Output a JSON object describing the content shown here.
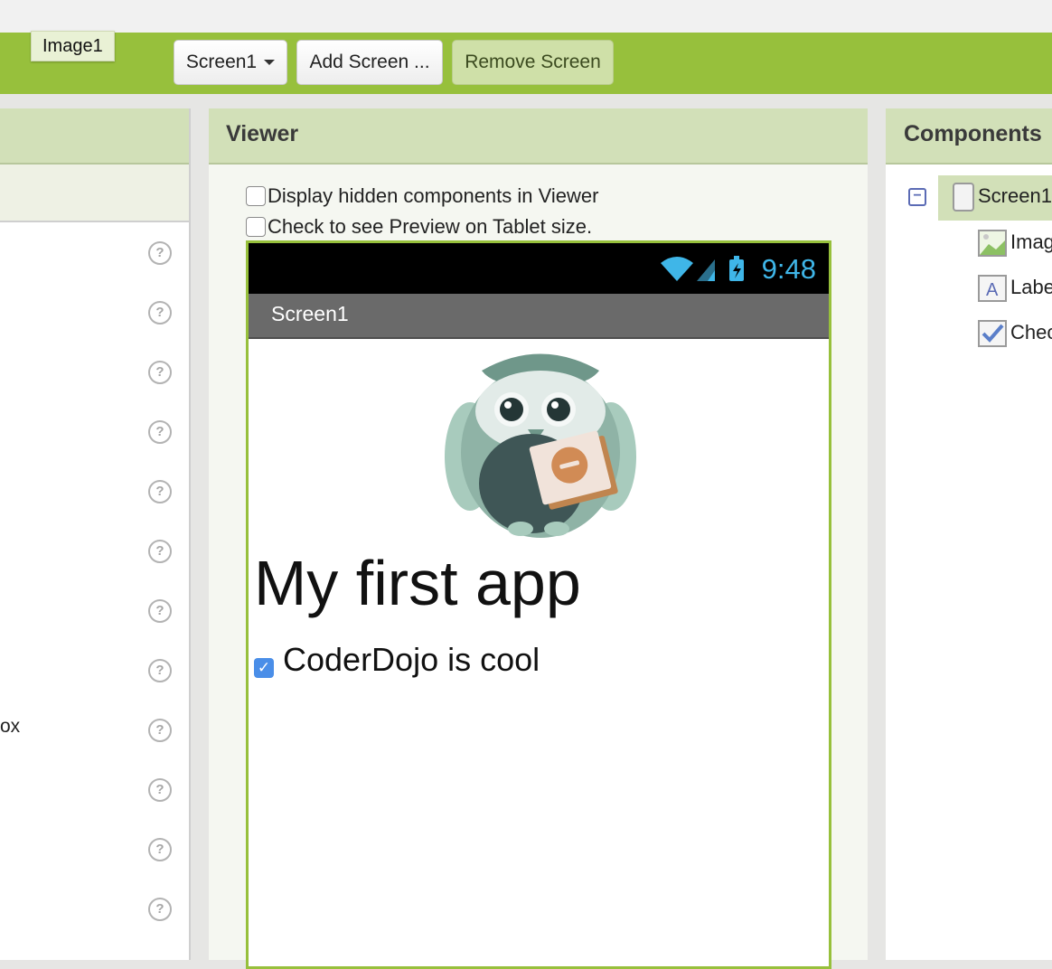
{
  "tooltip": "Image1",
  "toolbar": {
    "screen_dropdown": "Screen1",
    "add_screen": "Add Screen ...",
    "remove_screen": "Remove Screen"
  },
  "palette": {
    "partial_text": "ox"
  },
  "viewer": {
    "title": "Viewer",
    "checkbox_hidden": "Display hidden components in Viewer",
    "checkbox_tablet": "Check to see Preview on Tablet size.",
    "phone": {
      "time": "9:48",
      "screen_title": "Screen1",
      "heading": "My first app",
      "checkbox_label": "CoderDojo is cool",
      "checkbox_checked": true
    }
  },
  "components": {
    "title": "Components",
    "tree": [
      {
        "label": "Screen1",
        "icon": "screen-icon"
      },
      {
        "label": "Imag",
        "icon": "image-icon"
      },
      {
        "label": "Labe",
        "icon": "label-icon"
      },
      {
        "label": "Chec",
        "icon": "checkbox-icon"
      }
    ]
  },
  "colors": {
    "toolbar": "#97c03c",
    "panel_header": "#d2e0b8",
    "status_time": "#3fb6e8"
  }
}
